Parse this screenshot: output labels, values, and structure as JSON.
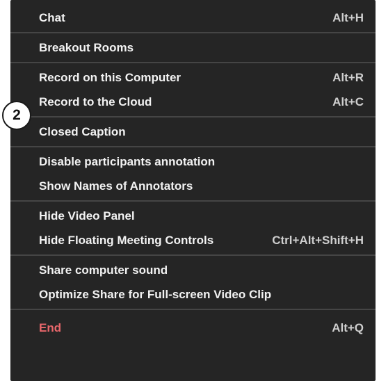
{
  "menu": {
    "groups": [
      {
        "items": [
          {
            "label": "Chat",
            "shortcut": "Alt+H"
          }
        ]
      },
      {
        "items": [
          {
            "label": "Breakout Rooms",
            "shortcut": ""
          }
        ]
      },
      {
        "items": [
          {
            "label": "Record on this Computer",
            "shortcut": "Alt+R"
          },
          {
            "label": "Record to the Cloud",
            "shortcut": "Alt+C"
          }
        ]
      },
      {
        "items": [
          {
            "label": "Closed Caption",
            "shortcut": ""
          }
        ]
      },
      {
        "items": [
          {
            "label": "Disable participants annotation",
            "shortcut": ""
          },
          {
            "label": "Show Names of Annotators",
            "shortcut": ""
          }
        ]
      },
      {
        "items": [
          {
            "label": "Hide Video Panel",
            "shortcut": ""
          },
          {
            "label": "Hide Floating Meeting Controls",
            "shortcut": "Ctrl+Alt+Shift+H"
          }
        ]
      },
      {
        "items": [
          {
            "label": "Share computer sound",
            "shortcut": ""
          },
          {
            "label": "Optimize Share for Full-screen Video Clip",
            "shortcut": ""
          }
        ]
      },
      {
        "items": [
          {
            "label": "End",
            "shortcut": "Alt+Q"
          }
        ]
      }
    ]
  },
  "callout": {
    "number": "2"
  },
  "colors": {
    "menu_background": "#252525",
    "text": "#f2f2f2",
    "shortcut": "#cfcfcf",
    "danger": "#e8676b",
    "divider": "#454545"
  }
}
